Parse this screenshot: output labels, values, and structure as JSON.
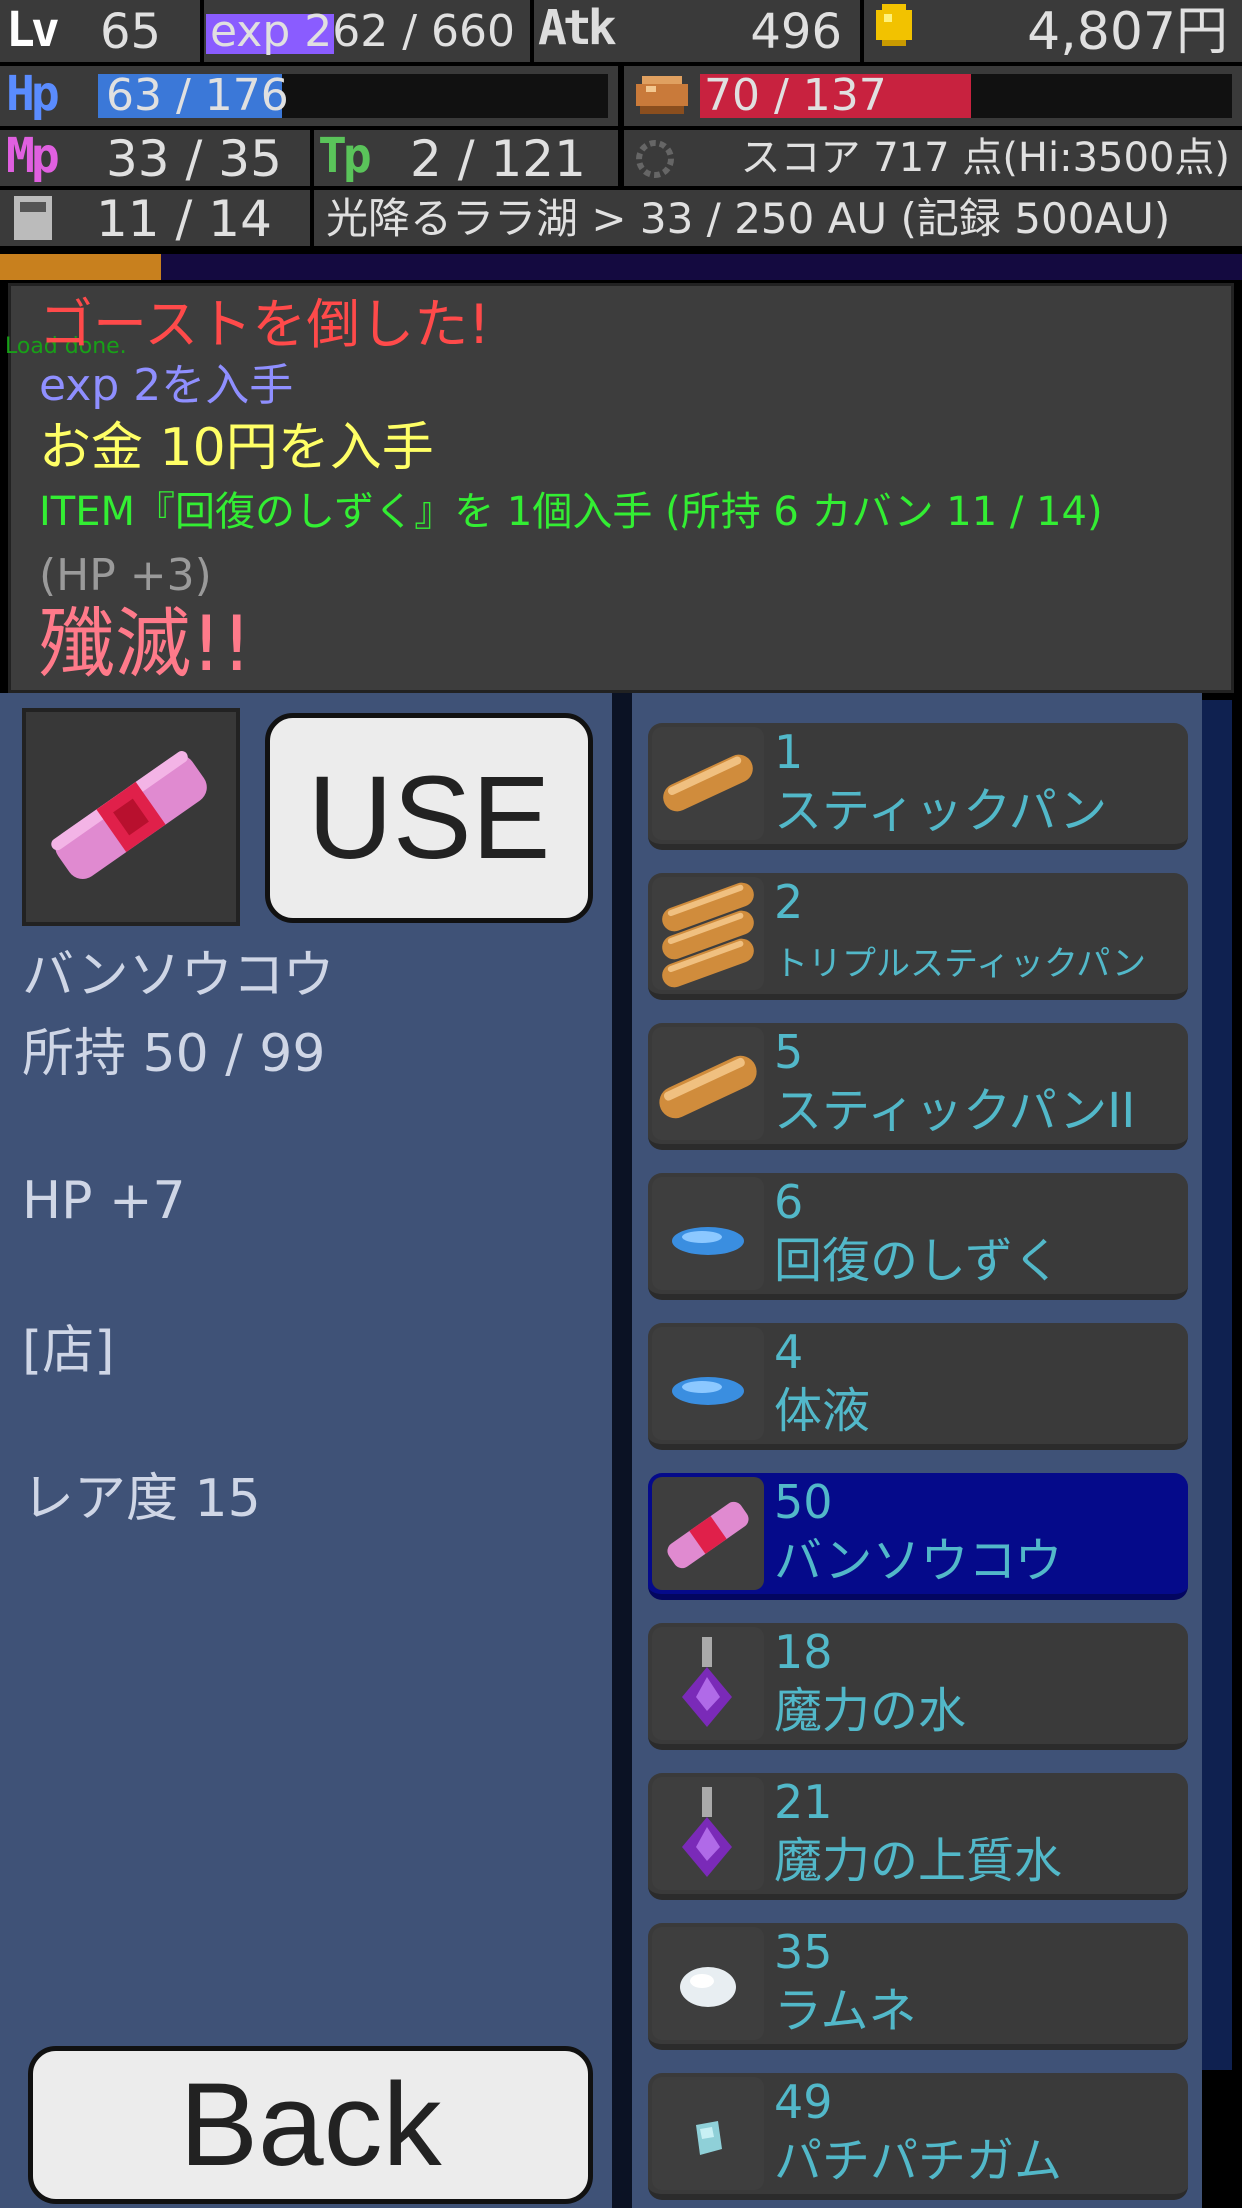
{
  "hud": {
    "lv_label": "Lv",
    "level": "65",
    "exp_text": "exp 262 / 660",
    "exp_fraction": 0.4,
    "atk_label": "Atk",
    "atk": "496",
    "money": "4,807円",
    "hp_label": "Hp",
    "hp_text": "63 / 176",
    "hp_fraction": 0.36,
    "food_text": "70 / 137",
    "food_fraction": 0.51,
    "mp_label": "Mp",
    "mp_text": "33 / 35",
    "tp_label": "Tp",
    "tp_text": "2 / 121",
    "score_text": "スコア 717 点(Hi:3500点)",
    "bag_text": "11 / 14",
    "location_text": "光降るララ湖 > 33 / 250 AU (記録 500AU)",
    "progress_fraction": 0.13,
    "colors": {
      "exp": "#8a5cff",
      "hp": "#3b78d8",
      "food": "#c8223f",
      "lv": "#ffffff",
      "hp_label": "#5a8cff",
      "mp_label": "#e060e0",
      "tp_label": "#5ac45a",
      "progress": "#c8801e"
    }
  },
  "log": {
    "debug": "Load done.",
    "lines": [
      {
        "text": "ゴーストを倒した!",
        "color": "#ff4a4a"
      },
      {
        "text": "exp 2を入手",
        "color": "#8f8fff"
      },
      {
        "text": "お金 10円を入手",
        "color": "#ffff66"
      },
      {
        "text": "ITEM『回復のしずく』を 1個入手 (所持 6 カバン 11 / 14)",
        "color": "#33ee33"
      },
      {
        "text": "(HP +3)",
        "color": "#9a9a9a"
      },
      {
        "text": "殲滅!!",
        "color": "#ff7a8a"
      }
    ]
  },
  "selected_item": {
    "icon": "bandage-icon",
    "name": "バンソウコウ",
    "owned": "所持 50 / 99",
    "effect": "HP +7",
    "source": "[店]",
    "rarity": "レア度 15"
  },
  "buttons": {
    "use": "USE",
    "back": "Back"
  },
  "items": [
    {
      "qty": "1",
      "name": "スティックパン",
      "icon": "bread-stick-icon",
      "selected": false
    },
    {
      "qty": "2",
      "name": "トリプルスティックパン",
      "icon": "triple-bread-icon",
      "selected": false
    },
    {
      "qty": "5",
      "name": "スティックパンII",
      "icon": "bread-stick-icon",
      "selected": false
    },
    {
      "qty": "6",
      "name": "回復のしずく",
      "icon": "blue-drop-icon",
      "selected": false
    },
    {
      "qty": "4",
      "name": "体液",
      "icon": "blue-drop-icon",
      "selected": false
    },
    {
      "qty": "50",
      "name": "バンソウコウ",
      "icon": "bandage-icon",
      "selected": true
    },
    {
      "qty": "18",
      "name": "魔力の水",
      "icon": "potion-icon",
      "selected": false
    },
    {
      "qty": "21",
      "name": "魔力の上質水",
      "icon": "potion-icon",
      "selected": false
    },
    {
      "qty": "35",
      "name": "ラムネ",
      "icon": "white-candy-icon",
      "selected": false
    },
    {
      "qty": "49",
      "name": "パチパチガム",
      "icon": "gum-icon",
      "selected": false
    }
  ]
}
